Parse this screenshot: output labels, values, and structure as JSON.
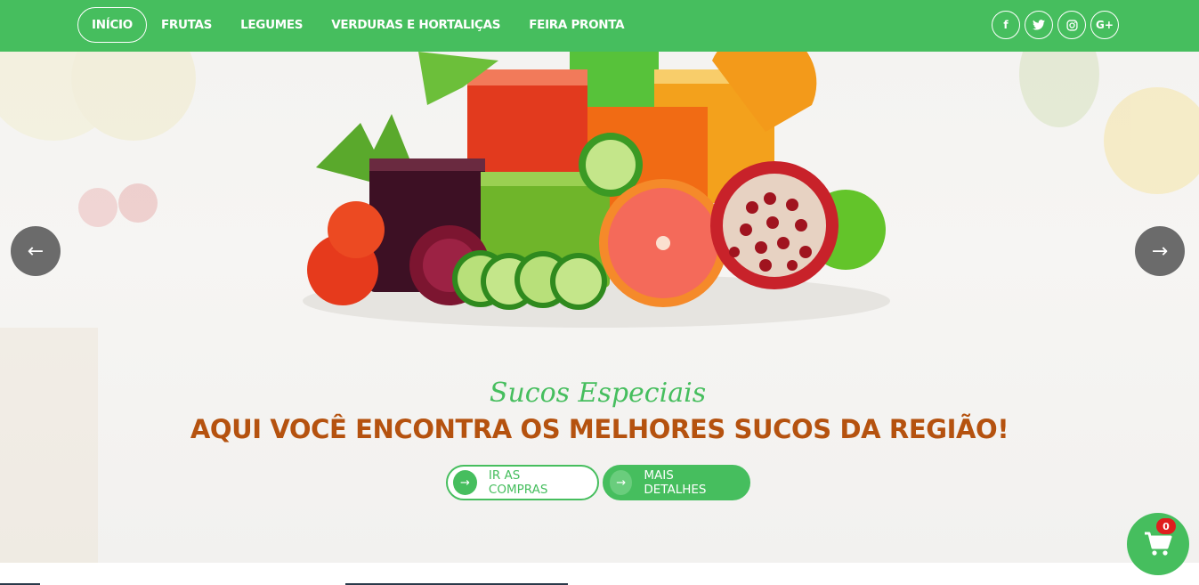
{
  "nav": {
    "items": [
      {
        "label": "INÍCIO",
        "active": true
      },
      {
        "label": "FRUTAS",
        "active": false
      },
      {
        "label": "LEGUMES",
        "active": false
      },
      {
        "label": "VERDURAS E HORTALIÇAS",
        "active": false
      },
      {
        "label": "FEIRA PRONTA",
        "active": false
      }
    ]
  },
  "social": [
    {
      "icon": "facebook-icon",
      "glyph": "f"
    },
    {
      "icon": "twitter-icon",
      "glyph": "🐦"
    },
    {
      "icon": "instagram-icon",
      "glyph": "◎"
    },
    {
      "icon": "google-plus-icon",
      "glyph": "G+"
    }
  ],
  "hero": {
    "subtitle": "Sucos Especiais",
    "headline": "AQUI VOCÊ ENCONTRA OS MELHORES SUCOS DA REGIÃO!",
    "arrow_prev": "←",
    "arrow_next": "→",
    "buttons": {
      "shop": {
        "label": "IR AS COMPRAS",
        "icon": "→"
      },
      "details": {
        "label": "MAIS DETALHES",
        "icon": "→"
      }
    }
  },
  "cart": {
    "count": "0"
  },
  "colors": {
    "brand_green": "#46be5e",
    "headline_orange": "#b5520f",
    "badge_red": "#e01e1e"
  }
}
